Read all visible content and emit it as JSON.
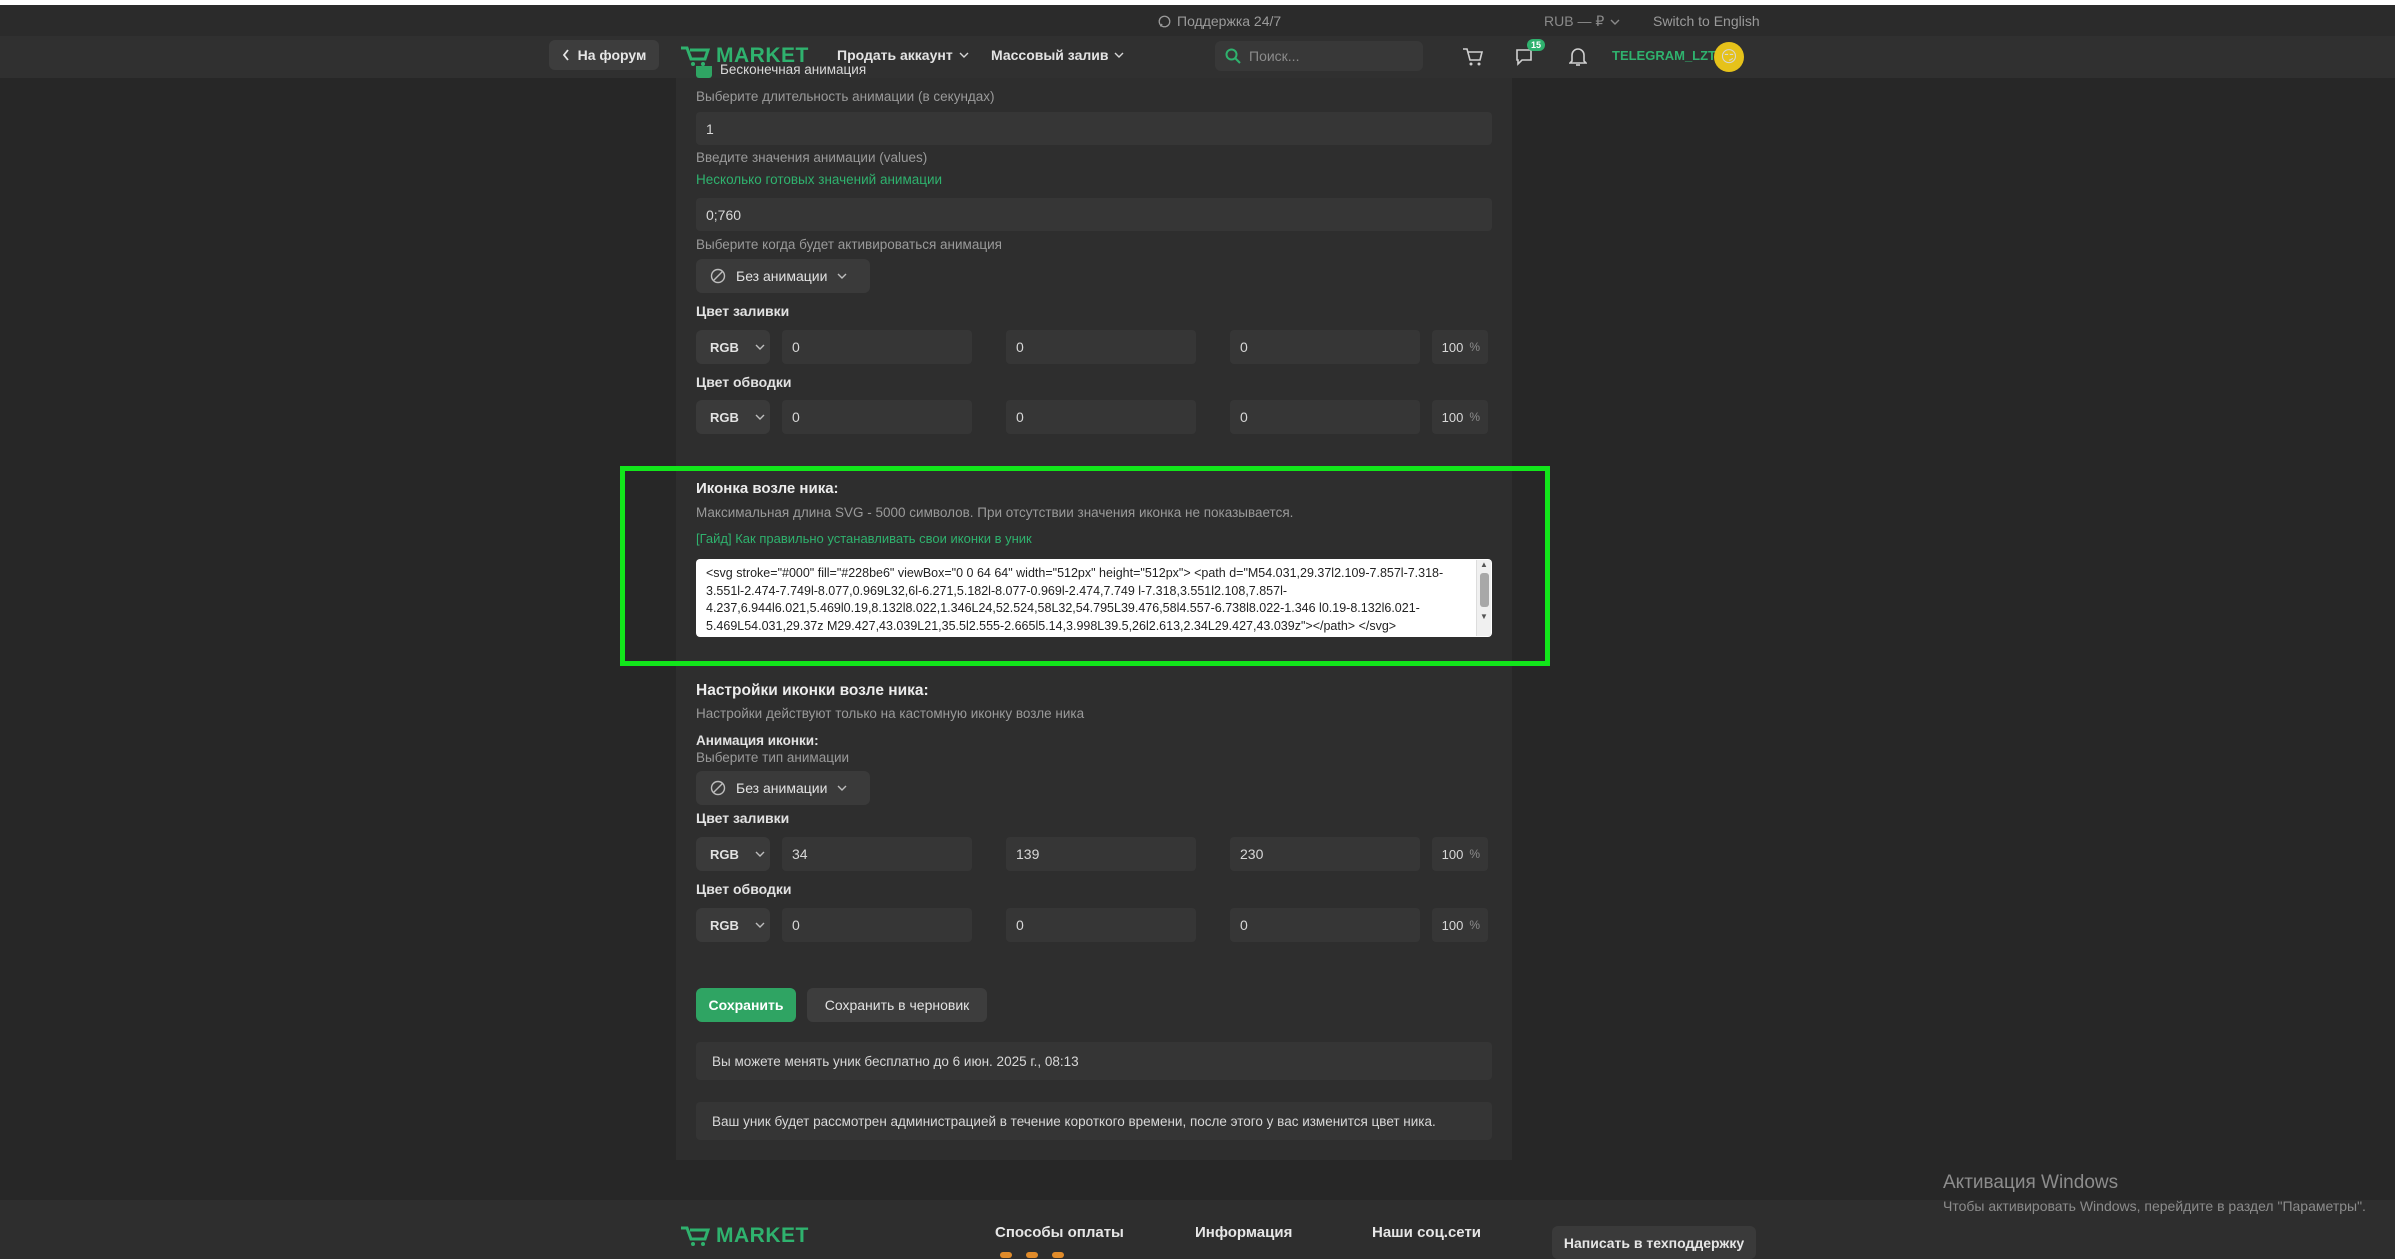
{
  "topbar": {
    "support": "Поддержка 24/7",
    "currency": "RUB — ₽",
    "language": "Switch to English"
  },
  "nav": {
    "back": "На форум",
    "logo": "MARKET",
    "menu_sell": "Продать аккаунт",
    "menu_mass": "Массовый залив",
    "search_placeholder": "Поиск...",
    "messages_badge": "15",
    "username": "TELEGRAM_LZT",
    "avatar": "😏"
  },
  "animation": {
    "partial_label": "Бесконечная анимация",
    "duration_label": "Выберите длительность анимации (в секундах)",
    "duration_value": "1",
    "values_label": "Введите значения анимации (values)",
    "values_link": "Несколько готовых значений анимации",
    "values_value": "0;760",
    "trigger_label": "Выберите когда будет активироваться анимация",
    "trigger_value": "Без анимации"
  },
  "fill1": {
    "label": "Цвет заливки",
    "mode": "RGB",
    "r": "0",
    "g": "0",
    "b": "0",
    "a": "100",
    "unit": "%"
  },
  "stroke1": {
    "label": "Цвет обводки",
    "mode": "RGB",
    "r": "0",
    "g": "0",
    "b": "0",
    "a": "100",
    "unit": "%"
  },
  "icon": {
    "title": "Иконка возле ника:",
    "hint": "Максимальная длина SVG - 5000 символов. При отсутствии значения иконка не показывается.",
    "guide": "[Гайд] Как правильно устанавливать свои иконки в уник",
    "svg_code": "<svg stroke=\"#000\" fill=\"#228be6\" viewBox=\"0 0 64 64\" width=\"512px\" height=\"512px\"> <path d=\"M54.031,29.37l2.109-7.857l-7.318-3.551l-2.474-7.749l-8.077,0.969L32,6l-6.271,5.182l-8.077-0.969l-2.474,7.749 l-7.318,3.551l2.108,7.857l-4.237,6.944l6.021,5.469l0.19,8.132l8.022,1.346L24,52.524,58L32,54.795L39.476,58l4.557-6.738l8.022-1.346 l0.19-8.132l6.021-5.469L54.031,29.37z M29.427,43.039L21,35.5l2.555-2.665l5.14,3.998L39.5,26l2.613,2.34L29.427,43.039z\"></path> </svg>"
  },
  "icon_settings": {
    "title": "Настройки иконки возле ника:",
    "hint": "Настройки действуют только на кастомную иконку возле ника",
    "anim_label": "Анимация иконки:",
    "anim_hint": "Выберите тип анимации",
    "anim_value": "Без анимации"
  },
  "fill2": {
    "label": "Цвет заливки",
    "mode": "RGB",
    "r": "34",
    "g": "139",
    "b": "230",
    "a": "100",
    "unit": "%"
  },
  "stroke2": {
    "label": "Цвет обводки",
    "mode": "RGB",
    "r": "0",
    "g": "0",
    "b": "0",
    "a": "100",
    "unit": "%"
  },
  "actions": {
    "save": "Сохранить",
    "draft": "Сохранить в черновик"
  },
  "notices": {
    "free_change": "Вы можете менять уник бесплатно до 6 июн. 2025 г., 08:13",
    "review": "Ваш уник будет рассмотрен администрацией в течение короткого времени, после этого у вас изменится цвет ника."
  },
  "footer": {
    "logo": "MARKET",
    "payments": "Способы оплаты",
    "info": "Информация",
    "social": "Наши соц.сети",
    "support_button": "Написать в техподдержку"
  },
  "watermark": {
    "line1": "Активация Windows",
    "line2": "Чтобы активировать Windows, перейдите в раздел \"Параметры\"."
  },
  "colors": {
    "accent": "#2fb26e",
    "highlight": "#12e61b"
  }
}
